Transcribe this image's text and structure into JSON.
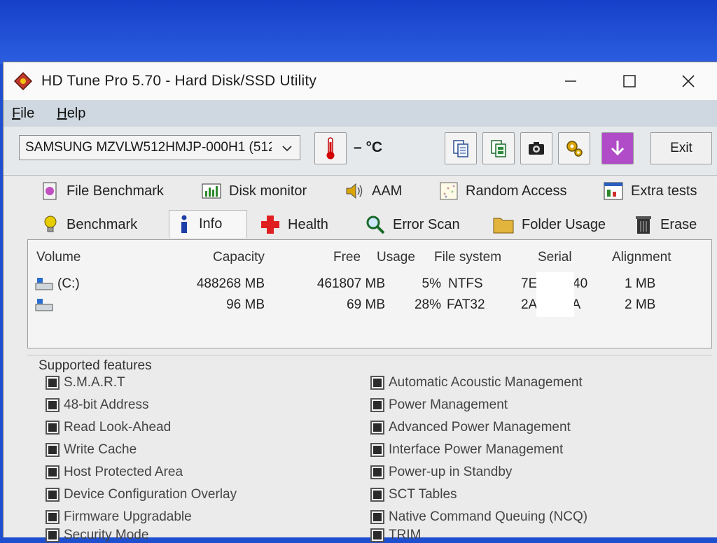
{
  "window": {
    "title": "HD Tune Pro 5.70 - Hard Disk/SSD Utility"
  },
  "menu": {
    "items": [
      {
        "label": "File",
        "accel": "F",
        "rest": "ile"
      },
      {
        "label": "Help",
        "accel": "H",
        "rest": "elp"
      }
    ]
  },
  "toolbar": {
    "drive": "SAMSUNG MZVLW512HMJP-000H1 (512",
    "temperature": "– °C",
    "exit_label": "Exit",
    "icons": [
      "copy-info-icon",
      "copy-all-icon",
      "screenshot-icon",
      "options-icon",
      "save-icon"
    ]
  },
  "tabs": {
    "row1": [
      "File Benchmark",
      "Disk monitor",
      "AAM",
      "Random Access",
      "Extra tests"
    ],
    "row2": [
      "Benchmark",
      "Info",
      "Health",
      "Error Scan",
      "Folder Usage",
      "Erase"
    ],
    "active": "Info"
  },
  "volumes": {
    "headers": [
      "Volume",
      "Capacity",
      "Free",
      "Usage",
      "File system",
      "Serial",
      "Alignment"
    ],
    "rows": [
      {
        "volume": "(C:)",
        "capacity": "488268 MB",
        "free": "461807 MB",
        "usage": "5%",
        "fs": "NTFS",
        "serial_a": "7E",
        "serial_b": "40",
        "alignment": "1 MB"
      },
      {
        "volume": "",
        "capacity": "96 MB",
        "free": "69 MB",
        "usage": "28%",
        "fs": "FAT32",
        "serial_a": "2A",
        "serial_b": "0A",
        "alignment": "2 MB"
      }
    ]
  },
  "features": {
    "title": "Supported features",
    "left": [
      "S.M.A.R.T",
      "48-bit Address",
      "Read Look-Ahead",
      "Write Cache",
      "Host Protected Area",
      "Device Configuration Overlay",
      "Firmware Upgradable",
      "Security Mode"
    ],
    "right": [
      "Automatic Acoustic Management",
      "Power Management",
      "Advanced Power Management",
      "Interface Power Management",
      "Power-up in Standby",
      "SCT Tables",
      "Native Command Queuing (NCQ)",
      "TRIM"
    ]
  }
}
